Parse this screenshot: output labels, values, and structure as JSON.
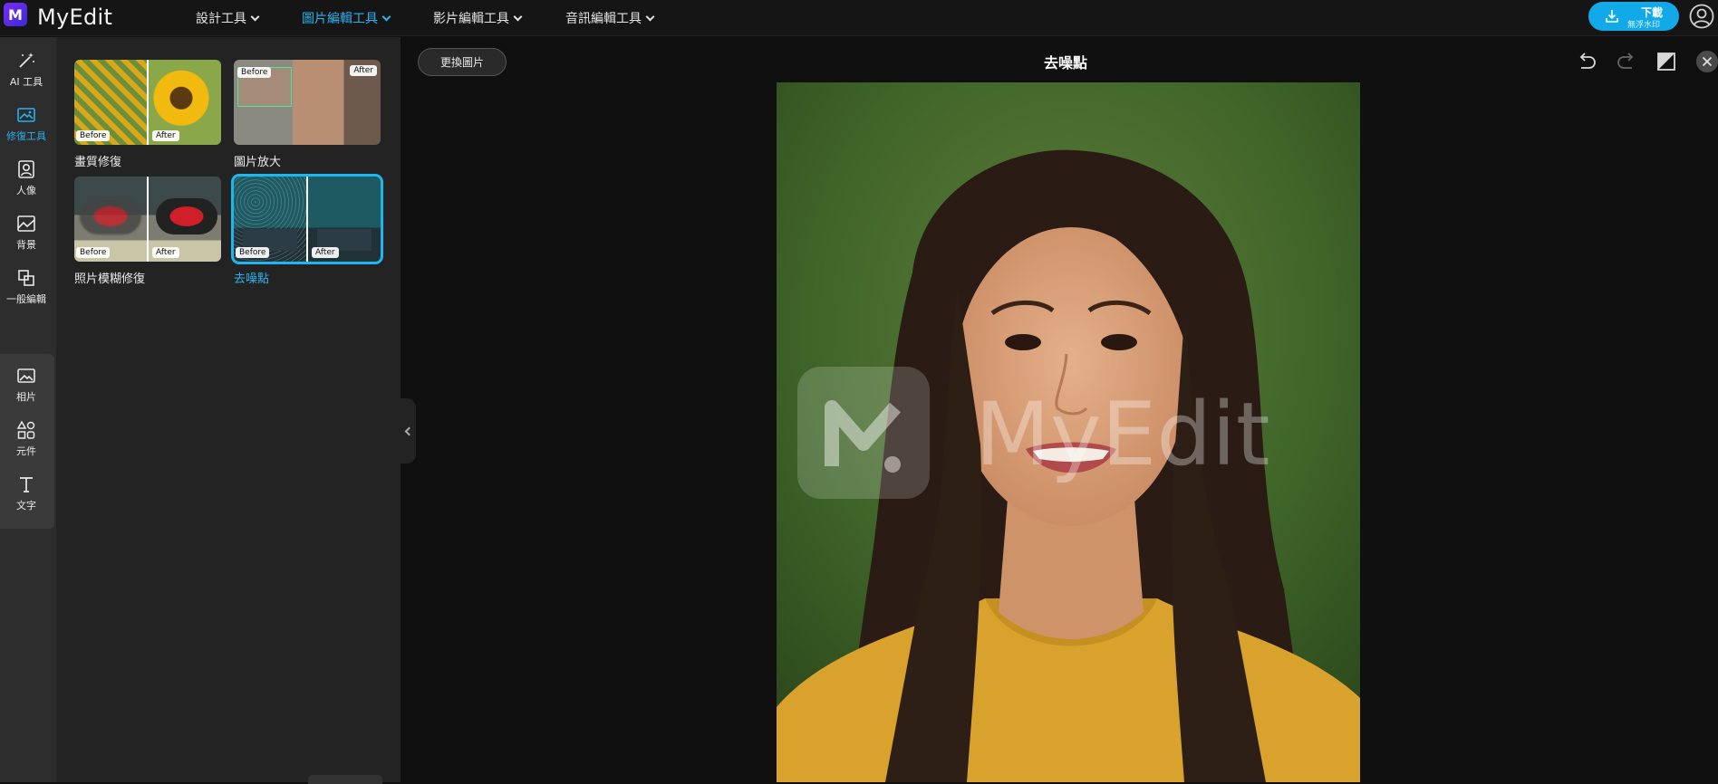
{
  "app": {
    "logo_letter": "M",
    "name": "MyEdit"
  },
  "nav": {
    "items": [
      {
        "label": "設計工具",
        "active": false
      },
      {
        "label": "圖片編輯工具",
        "active": true
      },
      {
        "label": "影片編輯工具",
        "active": false
      },
      {
        "label": "音訊編輯工具",
        "active": false
      }
    ]
  },
  "download": {
    "label": "下載",
    "sublabel": "無浮水印"
  },
  "rail": {
    "items": [
      {
        "label": "AI 工具",
        "icon": "magic-wand-icon"
      },
      {
        "label": "修復工具",
        "icon": "image-fix-icon",
        "active": true
      },
      {
        "label": "人像",
        "icon": "portrait-icon"
      },
      {
        "label": "背景",
        "icon": "background-icon"
      },
      {
        "label": "一般編輯",
        "icon": "crop-icon"
      }
    ],
    "lower": [
      {
        "label": "相片",
        "icon": "photo-icon"
      },
      {
        "label": "元件",
        "icon": "shapes-icon"
      },
      {
        "label": "文字",
        "icon": "text-icon"
      }
    ]
  },
  "panel": {
    "cards": [
      {
        "label": "畫質修復",
        "before": "Before",
        "after": "After",
        "selected": false
      },
      {
        "label": "圖片放大",
        "before": "Before",
        "after": "After",
        "selected": false
      },
      {
        "label": "照片模糊修復",
        "before": "Before",
        "after": "After",
        "selected": false
      },
      {
        "label": "去噪點",
        "before": "Before",
        "after": "After",
        "selected": true
      }
    ]
  },
  "canvas": {
    "replace_button": "更換圖片",
    "title": "去噪點",
    "watermark_text": "MyEdit"
  },
  "colors": {
    "accent": "#1fb6f0",
    "download_bg": "#12a9e9",
    "brand": "#6a2bf0"
  }
}
